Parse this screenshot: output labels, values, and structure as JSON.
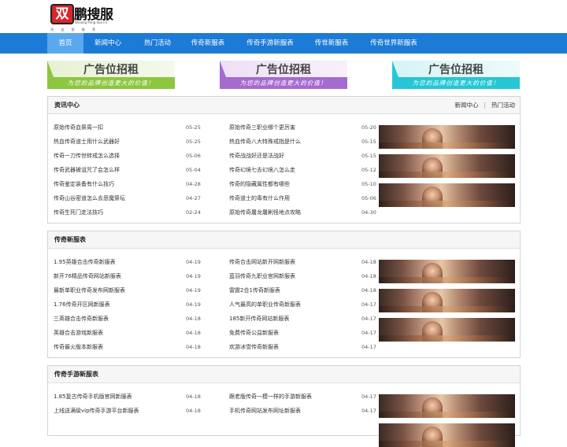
{
  "logo": {
    "mark": "双",
    "text": "鹏搜服",
    "en": "Shuang Peng Sou Fu",
    "dots": "顶 送 投 推 荐"
  },
  "nav": [
    {
      "label": "首页",
      "active": true
    },
    {
      "label": "新闻中心"
    },
    {
      "label": "热门活动"
    },
    {
      "label": "传奇新服表"
    },
    {
      "label": "传奇手游新服表"
    },
    {
      "label": "传世新服表"
    },
    {
      "label": "传奇世界新服表"
    }
  ],
  "ads": [
    {
      "title": "广告位招租",
      "subtitle": "为您的品牌创造更大的价值！",
      "color": "#8dc63f"
    },
    {
      "title": "广告位招租",
      "subtitle": "为您的品牌创造更大的价值！",
      "color": "#a56bd1"
    },
    {
      "title": "广告位招租",
      "subtitle": "为您的品牌创造更大的价值！",
      "color": "#26c6d6"
    }
  ],
  "news": {
    "title": "资讯中心",
    "link1": "新闻中心",
    "sep": "|",
    "link2": "热门活动",
    "left": [
      {
        "t": "原始传奇血祭周一扣",
        "d": "05-25"
      },
      {
        "t": "热血传奇道士用什么武器好",
        "d": "05-25"
      },
      {
        "t": "传奇一刀传世转戒怎么选择",
        "d": "05-06"
      },
      {
        "t": "传奇武器被诅咒了会怎么样",
        "d": "05-04"
      },
      {
        "t": "传奇鉴定装备有什么技巧",
        "d": "04-28"
      },
      {
        "t": "传奇山谷密道怎么去恶魔祭坛",
        "d": "04-27"
      },
      {
        "t": "传奇生死门走法技巧",
        "d": "02-24"
      }
    ],
    "right": [
      {
        "t": "原始传奇三职业哪个更厉害",
        "d": "05-20"
      },
      {
        "t": "热血传奇八大特殊戒指是什么",
        "d": "05-15"
      },
      {
        "t": "传奇战战好还是法战好",
        "d": "05-15"
      },
      {
        "t": "传奇幻境七去幻境八怎么走",
        "d": "05-12"
      },
      {
        "t": "传奇的隐藏属性都有哪些",
        "d": "05-10"
      },
      {
        "t": "传奇道士的毒有什么作用",
        "d": "05-06"
      },
      {
        "t": "原始传奇屠龙屠刷怪地点攻略",
        "d": "04-30"
      }
    ]
  },
  "servers": {
    "title": "传奇新服表",
    "left": [
      {
        "t": "1.95英雄合击传奇新服表",
        "d": "04-19"
      },
      {
        "t": "新开76精品传奇网站新服表",
        "d": "04-19"
      },
      {
        "t": "最新单职业传奇发布网新服表",
        "d": "04-19"
      },
      {
        "t": "1.76传奇开区网新服表",
        "d": "04-19"
      },
      {
        "t": "三英雄合击传奇新服表",
        "d": "04-18"
      },
      {
        "t": "英雄合击游戏新服表",
        "d": "04-18"
      },
      {
        "t": "传奇最火版本新服表",
        "d": "04-18"
      }
    ],
    "right": [
      {
        "t": "传奇合击网站新开网新服表",
        "d": "04-18"
      },
      {
        "t": "蓝羽传奇九职业官网新服表",
        "d": "04-18"
      },
      {
        "t": "雷霆2合1传奇新服表",
        "d": "04-18"
      },
      {
        "t": "人气最高的单职业传奇新服表",
        "d": "04-17"
      },
      {
        "t": "185新开传奇网站新服表",
        "d": "04-17"
      },
      {
        "t": "免费传奇公益新服表",
        "d": "04-17"
      },
      {
        "t": "欢游冰雪传奇新服表",
        "d": "04-17"
      }
    ]
  },
  "mobile": {
    "title": "传奇手游新服表",
    "left": [
      {
        "t": "1.85复古传奇手机版官网新服表",
        "d": "04-18"
      },
      {
        "t": "上线送满级vip传奇手游平台新服表",
        "d": "04-18"
      }
    ],
    "right": [
      {
        "t": "跟老版传奇一模一样的手游新服表",
        "d": "04-17"
      },
      {
        "t": "手机传奇网站发布网址新服表",
        "d": "04-17"
      }
    ]
  }
}
